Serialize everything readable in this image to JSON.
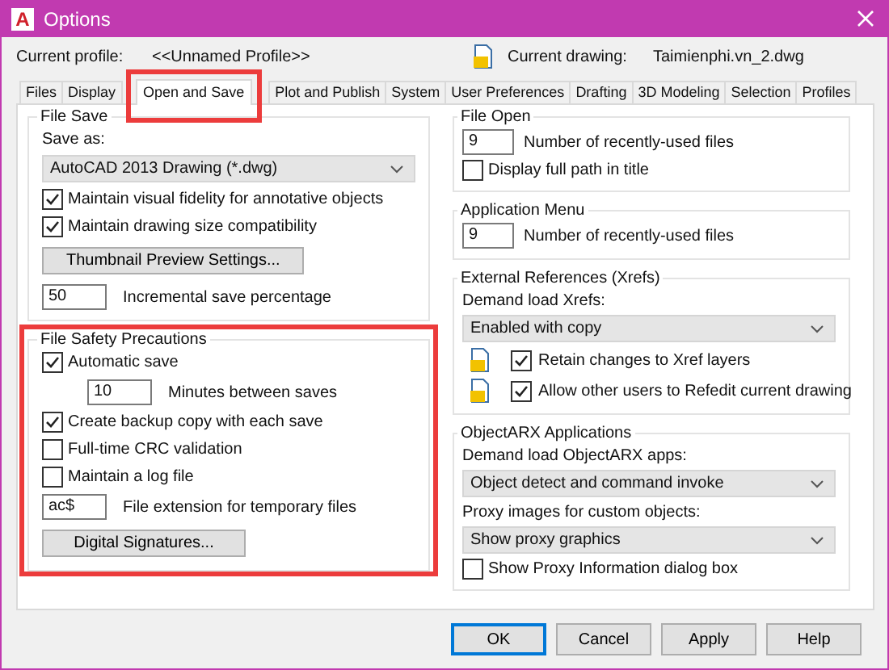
{
  "window": {
    "icon_text": "A",
    "title": "Options"
  },
  "profile": {
    "label": "Current profile:",
    "value": "<<Unnamed Profile>>",
    "drawing_label": "Current drawing:",
    "drawing_value": "Taimienphi.vn_2.dwg"
  },
  "tabs": [
    {
      "label": "Files",
      "selected": false,
      "highlighted": false
    },
    {
      "label": "Display",
      "selected": false,
      "highlighted": false
    },
    {
      "label": "Open and Save",
      "selected": true,
      "highlighted": true
    },
    {
      "label": "Plot and Publish",
      "selected": false,
      "highlighted": false
    },
    {
      "label": "System",
      "selected": false,
      "highlighted": false
    },
    {
      "label": "User Preferences",
      "selected": false,
      "highlighted": false
    },
    {
      "label": "Drafting",
      "selected": false,
      "highlighted": false
    },
    {
      "label": "3D Modeling",
      "selected": false,
      "highlighted": false
    },
    {
      "label": "Selection",
      "selected": false,
      "highlighted": false
    },
    {
      "label": "Profiles",
      "selected": false,
      "highlighted": false
    }
  ],
  "left_groups": [
    {
      "title": "File Save",
      "highlighted": false,
      "items": [
        {
          "kind": "label",
          "label": "Save as:"
        },
        {
          "kind": "select",
          "value": "AutoCAD 2013 Drawing (*.dwg)"
        },
        {
          "kind": "checkbox",
          "label": "Maintain visual fidelity for annotative objects",
          "checked": true
        },
        {
          "kind": "checkbox",
          "label": "Maintain drawing size compatibility",
          "checked": true
        },
        {
          "kind": "button",
          "label": "Thumbnail Preview Settings..."
        },
        {
          "kind": "number",
          "value": "50",
          "text": "Incremental save percentage"
        }
      ]
    },
    {
      "title": "File Safety Precautions",
      "highlighted": true,
      "items": [
        {
          "kind": "checkbox",
          "label": "Automatic save",
          "checked": true
        },
        {
          "kind": "indented-number",
          "value": "10",
          "text": "Minutes between saves"
        },
        {
          "kind": "checkbox",
          "label": "Create backup copy with each save",
          "checked": true
        },
        {
          "kind": "checkbox",
          "label": "Full-time CRC validation",
          "checked": false
        },
        {
          "kind": "checkbox",
          "label": "Maintain a log file",
          "checked": false
        },
        {
          "kind": "number",
          "value": "ac$",
          "text": "File extension for temporary files"
        },
        {
          "kind": "button",
          "label": "Digital Signatures..."
        }
      ]
    }
  ],
  "right_groups": [
    {
      "title": "File Open",
      "highlighted": false,
      "items": [
        {
          "kind": "number",
          "value": "9",
          "text": "Number of recently-used files"
        },
        {
          "kind": "checkbox",
          "label": "Display full path in title",
          "checked": false
        }
      ]
    },
    {
      "title": "Application Menu",
      "highlighted": false,
      "items": [
        {
          "kind": "number",
          "value": "9",
          "text": "Number of recently-used files"
        }
      ]
    },
    {
      "title": "External References (Xrefs)",
      "highlighted": false,
      "items": [
        {
          "kind": "label",
          "label": "Demand load Xrefs:"
        },
        {
          "kind": "select",
          "value": "Enabled with copy"
        },
        {
          "kind": "icon-checkbox",
          "label": "Retain changes to Xref layers",
          "checked": true
        },
        {
          "kind": "icon-checkbox",
          "label": "Allow other users to Refedit current drawing",
          "checked": true
        }
      ]
    },
    {
      "title": "ObjectARX Applications",
      "highlighted": false,
      "items": [
        {
          "kind": "label",
          "label": "Demand load ObjectARX apps:"
        },
        {
          "kind": "select",
          "value": "Object detect and command invoke"
        },
        {
          "kind": "label",
          "label": "Proxy images for custom objects:"
        },
        {
          "kind": "select",
          "value": "Show proxy graphics"
        },
        {
          "kind": "checkbox",
          "label": "Show Proxy Information dialog box",
          "checked": false
        }
      ]
    }
  ],
  "buttons": [
    {
      "label": "OK",
      "focused": true
    },
    {
      "label": "Cancel",
      "focused": false
    },
    {
      "label": "Apply",
      "focused": false
    },
    {
      "label": "Help",
      "focused": false
    }
  ]
}
